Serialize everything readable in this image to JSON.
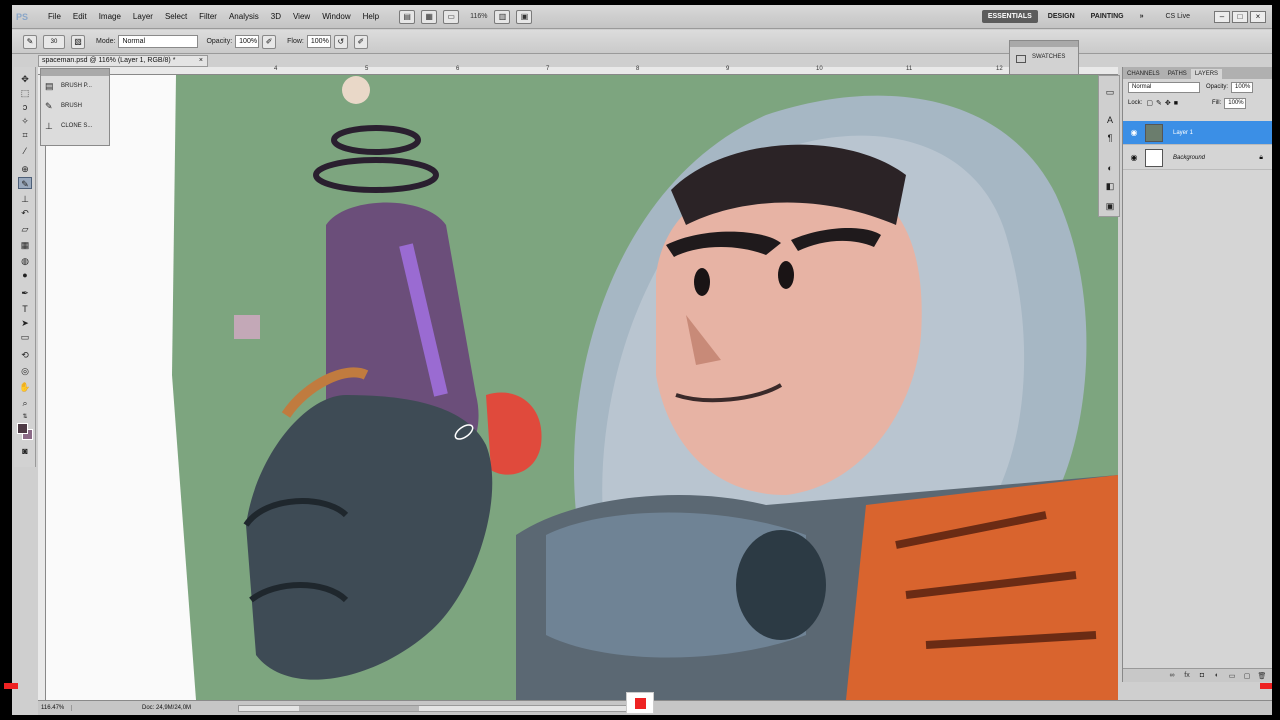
{
  "app": {
    "logo": "PS"
  },
  "menubar": {
    "items": [
      "File",
      "Edit",
      "Image",
      "Layer",
      "Select",
      "Filter",
      "Analysis",
      "3D",
      "View",
      "Window",
      "Help"
    ],
    "zoom_value": "116%",
    "workspaces": [
      "ESSENTIALS",
      "DESIGN",
      "PAINTING"
    ],
    "more": "»",
    "cs_live": "CS Live"
  },
  "options": {
    "brush_size": "30",
    "mode_label": "Mode:",
    "mode_value": "Normal",
    "opacity_label": "Opacity:",
    "opacity_value": "100%",
    "flow_label": "Flow:",
    "flow_value": "100%"
  },
  "document": {
    "tab_title": "spaceman.psd @ 116% (Layer 1, RGB/8) *",
    "close": "×"
  },
  "brush_presets": {
    "items": [
      {
        "label": "BRUSH P...",
        "icon": "brush-presets-icon"
      },
      {
        "label": "BRUSH",
        "icon": "brush-icon"
      },
      {
        "label": "CLONE S...",
        "icon": "clone-source-icon"
      }
    ]
  },
  "rulers": {
    "h_ticks": [
      "4",
      "5",
      "6",
      "7",
      "8",
      "9",
      "10",
      "11",
      "12"
    ]
  },
  "swatches_panel": {
    "label": "SWATCHES"
  },
  "layers_panel": {
    "tabs": [
      "CHANNELS",
      "PATHS",
      "LAYERS"
    ],
    "active_tab": "LAYERS",
    "blend_mode": "Normal",
    "opacity_label": "Opacity:",
    "opacity_value": "100%",
    "lock_label": "Lock:",
    "fill_label": "Fill:",
    "fill_value": "100%",
    "layers": [
      {
        "name": "Layer 1",
        "selected": true
      },
      {
        "name": "Background",
        "selected": false
      }
    ]
  },
  "statusbar": {
    "zoom": "116.47%",
    "doc_info": "Doc: 24,9M/24,0M"
  },
  "colors": {
    "foreground": "#4d3a45",
    "background": "#8b6a87",
    "selection": "#3b8fe6",
    "canvas_green": "#7da57f"
  }
}
